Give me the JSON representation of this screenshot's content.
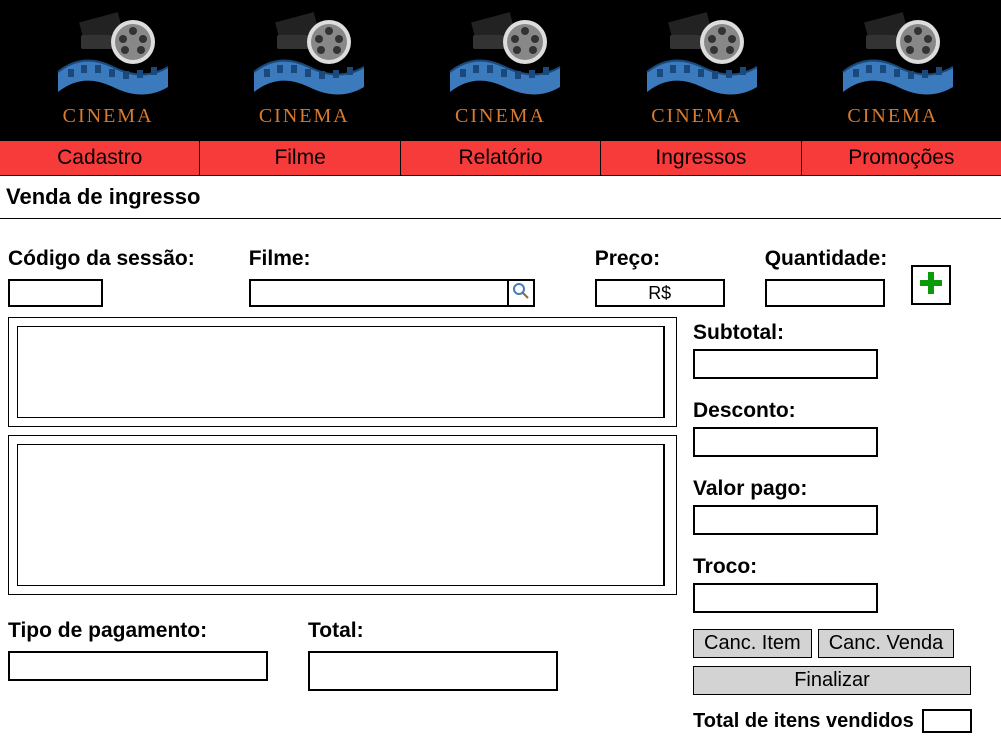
{
  "header": {
    "logo_label": "CINEMA",
    "logo_count": 5
  },
  "nav": {
    "items": [
      {
        "label": "Cadastro"
      },
      {
        "label": "Filme"
      },
      {
        "label": "Relatório"
      },
      {
        "label": "Ingressos"
      },
      {
        "label": "Promoções"
      }
    ]
  },
  "page": {
    "title": "Venda de ingresso"
  },
  "form": {
    "sessao_label": "Código da sessão:",
    "sessao_value": "",
    "filme_label": "Filme:",
    "filme_value": "",
    "preco_label": "Preço:",
    "preco_value": "R$",
    "qtd_label": "Quantidade:",
    "qtd_value": ""
  },
  "payment": {
    "tipo_label": "Tipo de pagamento:",
    "tipo_value": "",
    "total_label": "Total:",
    "total_value": ""
  },
  "side": {
    "subtotal_label": "Subtotal:",
    "subtotal_value": "",
    "desconto_label": "Desconto:",
    "desconto_value": "",
    "valor_pago_label": "Valor pago:",
    "valor_pago_value": "",
    "troco_label": "Troco:",
    "troco_value": "",
    "canc_item_label": "Canc. Item",
    "canc_venda_label": "Canc. Venda",
    "finalizar_label": "Finalizar",
    "total_itens_label": "Total de itens vendidos",
    "total_itens_value": ""
  }
}
